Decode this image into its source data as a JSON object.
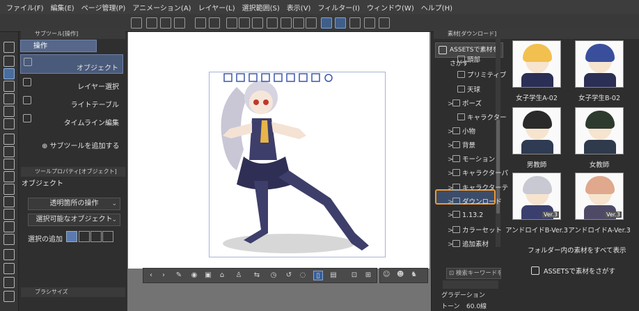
{
  "menu": [
    "ファイル(F)",
    "編集(E)",
    "ページ管理(P)",
    "アニメーション(A)",
    "レイヤー(L)",
    "選択範囲(S)",
    "表示(V)",
    "フィルター(I)",
    "ウィンドウ(W)",
    "ヘルプ(H)"
  ],
  "subtool_panel": {
    "header": "サブツール[操作]",
    "tab": "操作",
    "items": [
      "オブジェクト",
      "レイヤー選択",
      "ライトテーブル",
      "タイムライン編集"
    ],
    "add_label": "サブツールを追加する"
  },
  "tool_property": {
    "header": "ツールプロパティ[オブジェクト]",
    "title": "オブジェクト",
    "dropdown_transparent": "透明箇所の操作",
    "dropdown_selectable": "選択可能なオブジェクト",
    "add_selection_label": "選択の追加"
  },
  "brush_size": {
    "header": "ブラシサイズ"
  },
  "material_panel": {
    "header": "素材[ダウンロード]",
    "assets_button": "ASSETSで素材をさがす",
    "tree": [
      {
        "label": "頭部",
        "caret": ""
      },
      {
        "label": "プリミティブ",
        "caret": ""
      },
      {
        "label": "天球",
        "caret": ""
      },
      {
        "label": "ポーズ",
        "caret": ">"
      },
      {
        "label": "キャラクター",
        "caret": ""
      },
      {
        "label": "小物",
        "caret": ">"
      },
      {
        "label": "背景",
        "caret": ">"
      },
      {
        "label": "モーション",
        "caret": ">"
      },
      {
        "label": "キャラクターパ",
        "caret": ">"
      },
      {
        "label": "キャラクターテ",
        "caret": ">"
      },
      {
        "label": "ダウンロード",
        "caret": ">"
      },
      {
        "label": "1.13.2",
        "caret": ">"
      },
      {
        "label": "カラーセット",
        "caret": ">"
      },
      {
        "label": "追加素材",
        "caret": ">"
      }
    ],
    "thumbnails": [
      {
        "caption": "女子学生A-02",
        "hair": "#f2c04f",
        "body": "#2b2f55",
        "badge": ""
      },
      {
        "caption": "女子学生B-02",
        "hair": "#3a4f9c",
        "body": "#2b2f55",
        "badge": ""
      },
      {
        "caption": "男教師",
        "hair": "#2a2a2a",
        "body": "#2e3b52",
        "badge": ""
      },
      {
        "caption": "女教師",
        "hair": "#2d3b2f",
        "body": "#2f3a4c",
        "badge": ""
      },
      {
        "caption": "アンドロイドB-Ver.3",
        "hair": "#c9c9d4",
        "body": "#3a3f6e",
        "badge": "Ver.3"
      },
      {
        "caption": "アンドロイドA-Ver.3",
        "hair": "#e0a88c",
        "body": "#4e4a66",
        "badge": "Ver.3"
      }
    ],
    "show_all": "フォルダー内の素材をすべて表示",
    "assets_button_bottom": "ASSETSで素材をさがす",
    "search_placeholder": "検索キーワードを入",
    "bottom_rows": [
      "グラデーション",
      "トーン",
      "60.0線"
    ]
  }
}
